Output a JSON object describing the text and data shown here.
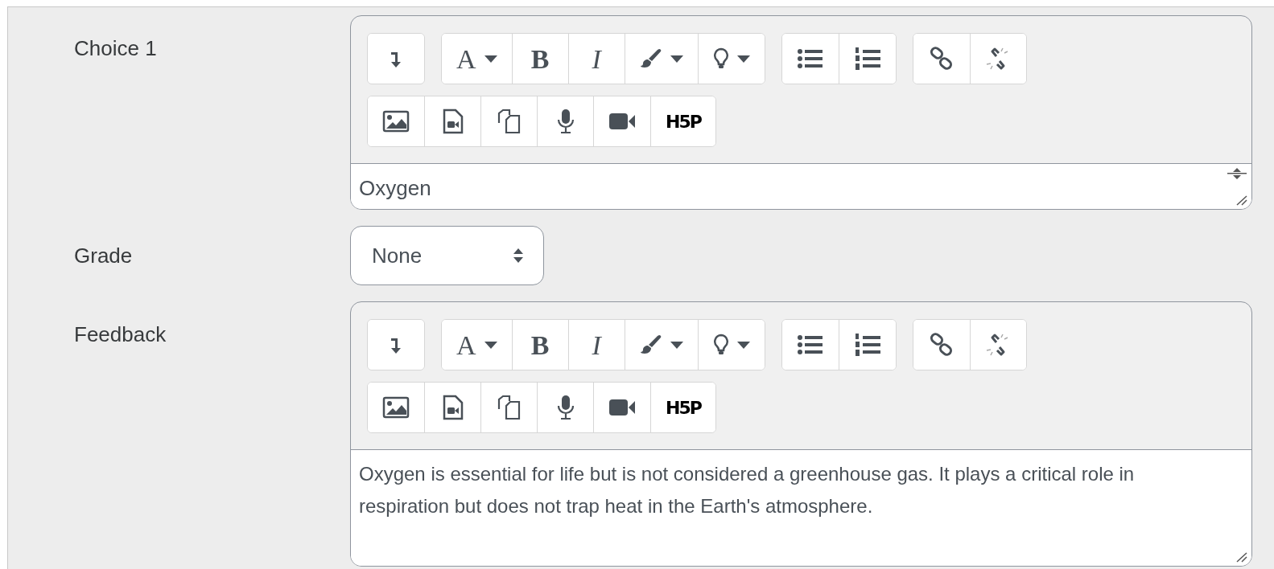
{
  "fields": [
    {
      "kind": "editor",
      "label": "Choice 1",
      "value": "Oxygen",
      "scrollbar": true,
      "toolbar": [
        [
          [
            {
              "kind": "icon",
              "dropdown": false
            }
          ],
          [
            {
              "kind": "text",
              "label": "A",
              "dropdown": true
            },
            {
              "kind": "text",
              "label": "B",
              "dropdown": false
            },
            {
              "kind": "text",
              "label": "I",
              "dropdown": false
            },
            {
              "kind": "icon",
              "dropdown": true
            },
            {
              "kind": "icon",
              "dropdown": true
            }
          ],
          [
            {
              "kind": "icon",
              "dropdown": false
            },
            {
              "kind": "icon",
              "dropdown": false
            }
          ],
          [
            {
              "kind": "icon",
              "dropdown": false
            },
            {
              "kind": "icon",
              "dropdown": false
            }
          ]
        ],
        [
          [
            {
              "kind": "icon",
              "dropdown": false
            },
            {
              "kind": "icon",
              "dropdown": false
            },
            {
              "kind": "icon",
              "dropdown": false
            },
            {
              "kind": "icon",
              "dropdown": false
            },
            {
              "kind": "icon",
              "dropdown": false
            },
            {
              "kind": "text",
              "label": "H5P",
              "dropdown": false
            }
          ]
        ]
      ]
    },
    {
      "kind": "select",
      "label": "Grade",
      "value": "None"
    },
    {
      "kind": "editor",
      "label": "Feedback",
      "value": "Oxygen is essential for life but is not considered a greenhouse gas. It plays a critical role in respiration but does not trap heat in the Earth's atmosphere.",
      "scrollbar": false,
      "toolbar": [
        [
          [
            {
              "kind": "icon",
              "dropdown": false
            }
          ],
          [
            {
              "kind": "text",
              "label": "A",
              "dropdown": true
            },
            {
              "kind": "text",
              "label": "B",
              "dropdown": false
            },
            {
              "kind": "text",
              "label": "I",
              "dropdown": false
            },
            {
              "kind": "icon",
              "dropdown": true
            },
            {
              "kind": "icon",
              "dropdown": true
            }
          ],
          [
            {
              "kind": "icon",
              "dropdown": false
            },
            {
              "kind": "icon",
              "dropdown": false
            }
          ],
          [
            {
              "kind": "icon",
              "dropdown": false
            },
            {
              "kind": "icon",
              "dropdown": false
            }
          ]
        ],
        [
          [
            {
              "kind": "icon",
              "dropdown": false
            },
            {
              "kind": "icon",
              "dropdown": false
            },
            {
              "kind": "icon",
              "dropdown": false
            },
            {
              "kind": "icon",
              "dropdown": false
            },
            {
              "kind": "icon",
              "dropdown": false
            },
            {
              "kind": "text",
              "label": "H5P",
              "dropdown": false
            }
          ]
        ]
      ]
    }
  ]
}
